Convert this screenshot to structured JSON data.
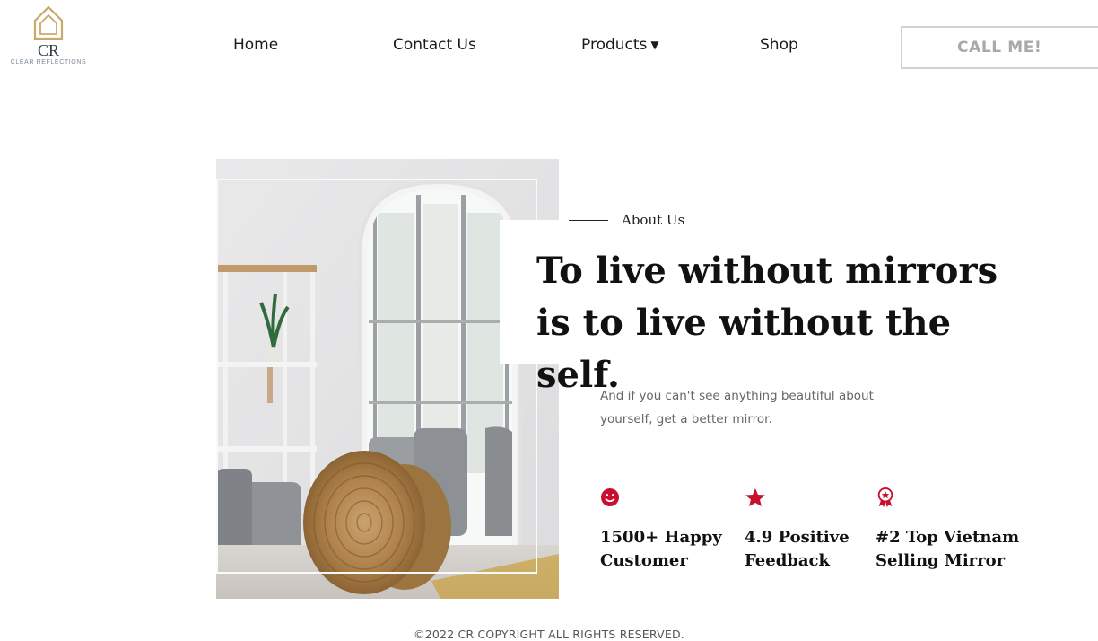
{
  "brand": {
    "mark": "CR",
    "name": "CLEAR REFLECTIONS"
  },
  "nav": {
    "home": "Home",
    "contact": "Contact Us",
    "products": "Products",
    "shop": "Shop",
    "products_caret_icon": "caret-down-icon"
  },
  "cta": {
    "label": "CALL ME!"
  },
  "about": {
    "eyebrow": "About Us",
    "headline": "To live without mirrors is to live without the self.",
    "body": "And if you can't see anything beautiful about yourself, get a better mirror."
  },
  "stats": [
    {
      "icon": "smiley-icon",
      "label": "1500+ Happy\nCustomer"
    },
    {
      "icon": "star-icon",
      "label": "4.9 Positive\nFeedback"
    },
    {
      "icon": "award-badge-icon",
      "label": "#2 Top Vietnam\nSelling Mirror"
    }
  ],
  "footer": {
    "copyright": "©2022 CR COPYRIGHT ALL RIGHTS RESERVED."
  },
  "colors": {
    "accent": "#c8102e",
    "logo_gold": "#c9a96b",
    "text_dark": "#111111",
    "muted": "#666666"
  }
}
